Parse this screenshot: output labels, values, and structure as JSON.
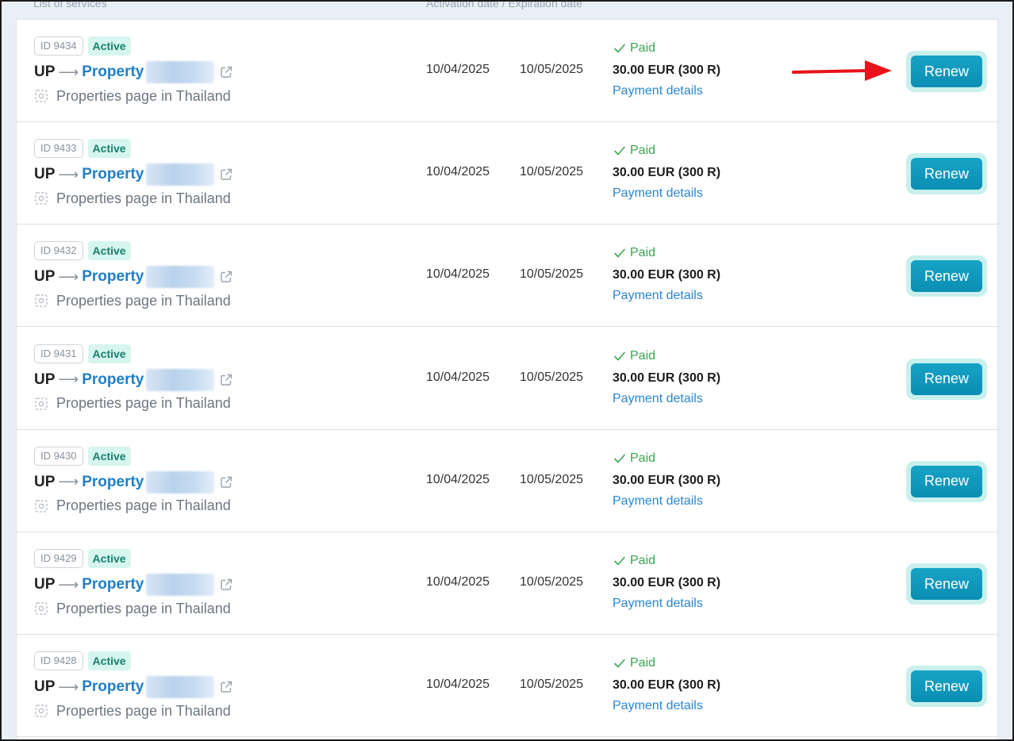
{
  "header": {
    "col_services": "List of services",
    "col_dates": "Activation date / Expiration date"
  },
  "colors": {
    "accent": "#0b8eb3",
    "link": "#1f7ec7",
    "paid_green": "#3aa651",
    "active_badge_bg": "#d6f5ee",
    "annotation_arrow": "#e8131b"
  },
  "rows": [
    {
      "id": "ID 9434",
      "status": "Active",
      "prefix": "UP",
      "link": "Property",
      "subtitle": "Properties page in Thailand",
      "activation": "10/04/2025",
      "expiration": "10/05/2025",
      "payment_status": "Paid",
      "price": "30.00 EUR (300 R)",
      "payment_details": "Payment details",
      "action": "Renew"
    },
    {
      "id": "ID 9433",
      "status": "Active",
      "prefix": "UP",
      "link": "Property",
      "subtitle": "Properties page in Thailand",
      "activation": "10/04/2025",
      "expiration": "10/05/2025",
      "payment_status": "Paid",
      "price": "30.00 EUR (300 R)",
      "payment_details": "Payment details",
      "action": "Renew"
    },
    {
      "id": "ID 9432",
      "status": "Active",
      "prefix": "UP",
      "link": "Property",
      "subtitle": "Properties page in Thailand",
      "activation": "10/04/2025",
      "expiration": "10/05/2025",
      "payment_status": "Paid",
      "price": "30.00 EUR (300 R)",
      "payment_details": "Payment details",
      "action": "Renew"
    },
    {
      "id": "ID 9431",
      "status": "Active",
      "prefix": "UP",
      "link": "Property",
      "subtitle": "Properties page in Thailand",
      "activation": "10/04/2025",
      "expiration": "10/05/2025",
      "payment_status": "Paid",
      "price": "30.00 EUR (300 R)",
      "payment_details": "Payment details",
      "action": "Renew"
    },
    {
      "id": "ID 9430",
      "status": "Active",
      "prefix": "UP",
      "link": "Property",
      "subtitle": "Properties page in Thailand",
      "activation": "10/04/2025",
      "expiration": "10/05/2025",
      "payment_status": "Paid",
      "price": "30.00 EUR (300 R)",
      "payment_details": "Payment details",
      "action": "Renew"
    },
    {
      "id": "ID 9429",
      "status": "Active",
      "prefix": "UP",
      "link": "Property",
      "subtitle": "Properties page in Thailand",
      "activation": "10/04/2025",
      "expiration": "10/05/2025",
      "payment_status": "Paid",
      "price": "30.00 EUR (300 R)",
      "payment_details": "Payment details",
      "action": "Renew"
    },
    {
      "id": "ID 9428",
      "status": "Active",
      "prefix": "UP",
      "link": "Property",
      "subtitle": "Properties page in Thailand",
      "activation": "10/04/2025",
      "expiration": "10/05/2025",
      "payment_status": "Paid",
      "price": "30.00 EUR (300 R)",
      "payment_details": "Payment details",
      "action": "Renew"
    }
  ]
}
